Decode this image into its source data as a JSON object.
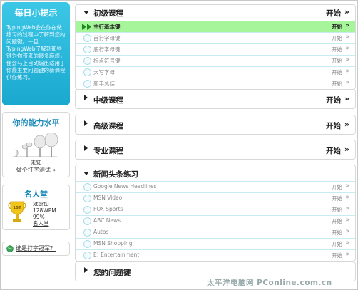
{
  "tip": {
    "title": "每日小提示",
    "text": "TypingWeb会在你在做练习的过程中了解到您的问题键。一旦TypingWeb了解到那些键为你带来的最多麻烦，便会马上自动编出适用于你最主要问题键的新课程供你练习。"
  },
  "skill": {
    "title": "你的能力水平",
    "line1": "未知",
    "line2": "做个打字测试 »"
  },
  "fame": {
    "title": "名人堂",
    "rank": "1ST",
    "user": "xtertu",
    "wpm": "128WPM",
    "accuracy": "99%",
    "link": "名人堂"
  },
  "ask": {
    "label": "谁是打字冠军？"
  },
  "watermark": "太平洋电脑网 PConline.com.cn",
  "courses": {
    "beginner": {
      "title": "初级课程",
      "start": "开始",
      "lessons": [
        {
          "label": "主行基本键",
          "start": "开始"
        },
        {
          "label": "首行字母键",
          "start": "开始"
        },
        {
          "label": "底行字母键",
          "start": "开始"
        },
        {
          "label": "标点符号键",
          "start": "开始"
        },
        {
          "label": "大写字母",
          "start": "开始"
        },
        {
          "label": "新手总结",
          "start": "开始"
        }
      ]
    },
    "intermediate": {
      "title": "中级课程",
      "start": "开始"
    },
    "advanced": {
      "title": "高级课程",
      "start": "开始"
    },
    "professional": {
      "title": "专业课程",
      "start": "开始"
    },
    "news": {
      "title": "新闻头条练习",
      "items": [
        {
          "label": "Google News Headlines",
          "start": "开始"
        },
        {
          "label": "MSN Video",
          "start": "开始"
        },
        {
          "label": "FOX Sports",
          "start": "开始"
        },
        {
          "label": "ABC News",
          "start": "开始"
        },
        {
          "label": "Autos",
          "start": "开始"
        },
        {
          "label": "MSN Shopping",
          "start": "开始"
        },
        {
          "label": "E! Entertainment",
          "start": "开始"
        }
      ]
    },
    "problem_keys": {
      "title": "您的问题键"
    }
  },
  "raquo": "»",
  "colors": {
    "accent": "#1aa8cf",
    "active_row": "#a7f59a",
    "heading": "#1c8ab8"
  }
}
